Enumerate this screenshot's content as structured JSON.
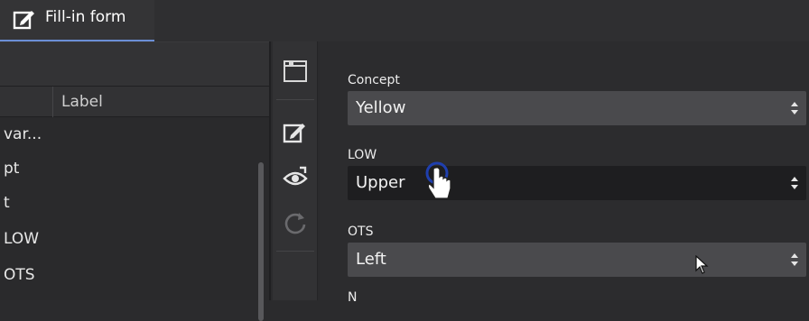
{
  "tab": {
    "label": "Fill-in form",
    "icon": "edit-form-icon"
  },
  "table": {
    "column_label": "Label",
    "rows": [
      "var...",
      "pt",
      "t",
      "LOW",
      "OTS"
    ]
  },
  "strip": {
    "icons": [
      "panel-icon",
      "edit-icon",
      "preview-icon",
      "refresh-icon"
    ]
  },
  "form": {
    "fields": [
      {
        "label": "Concept",
        "value": "Yellow"
      },
      {
        "label": "LOW",
        "value": "Upper"
      },
      {
        "label": "OTS",
        "value": "Left"
      }
    ],
    "partial_label": "N"
  },
  "colors": {
    "accent": "#6b8fd6",
    "focus_ring": "#1f3fae"
  }
}
